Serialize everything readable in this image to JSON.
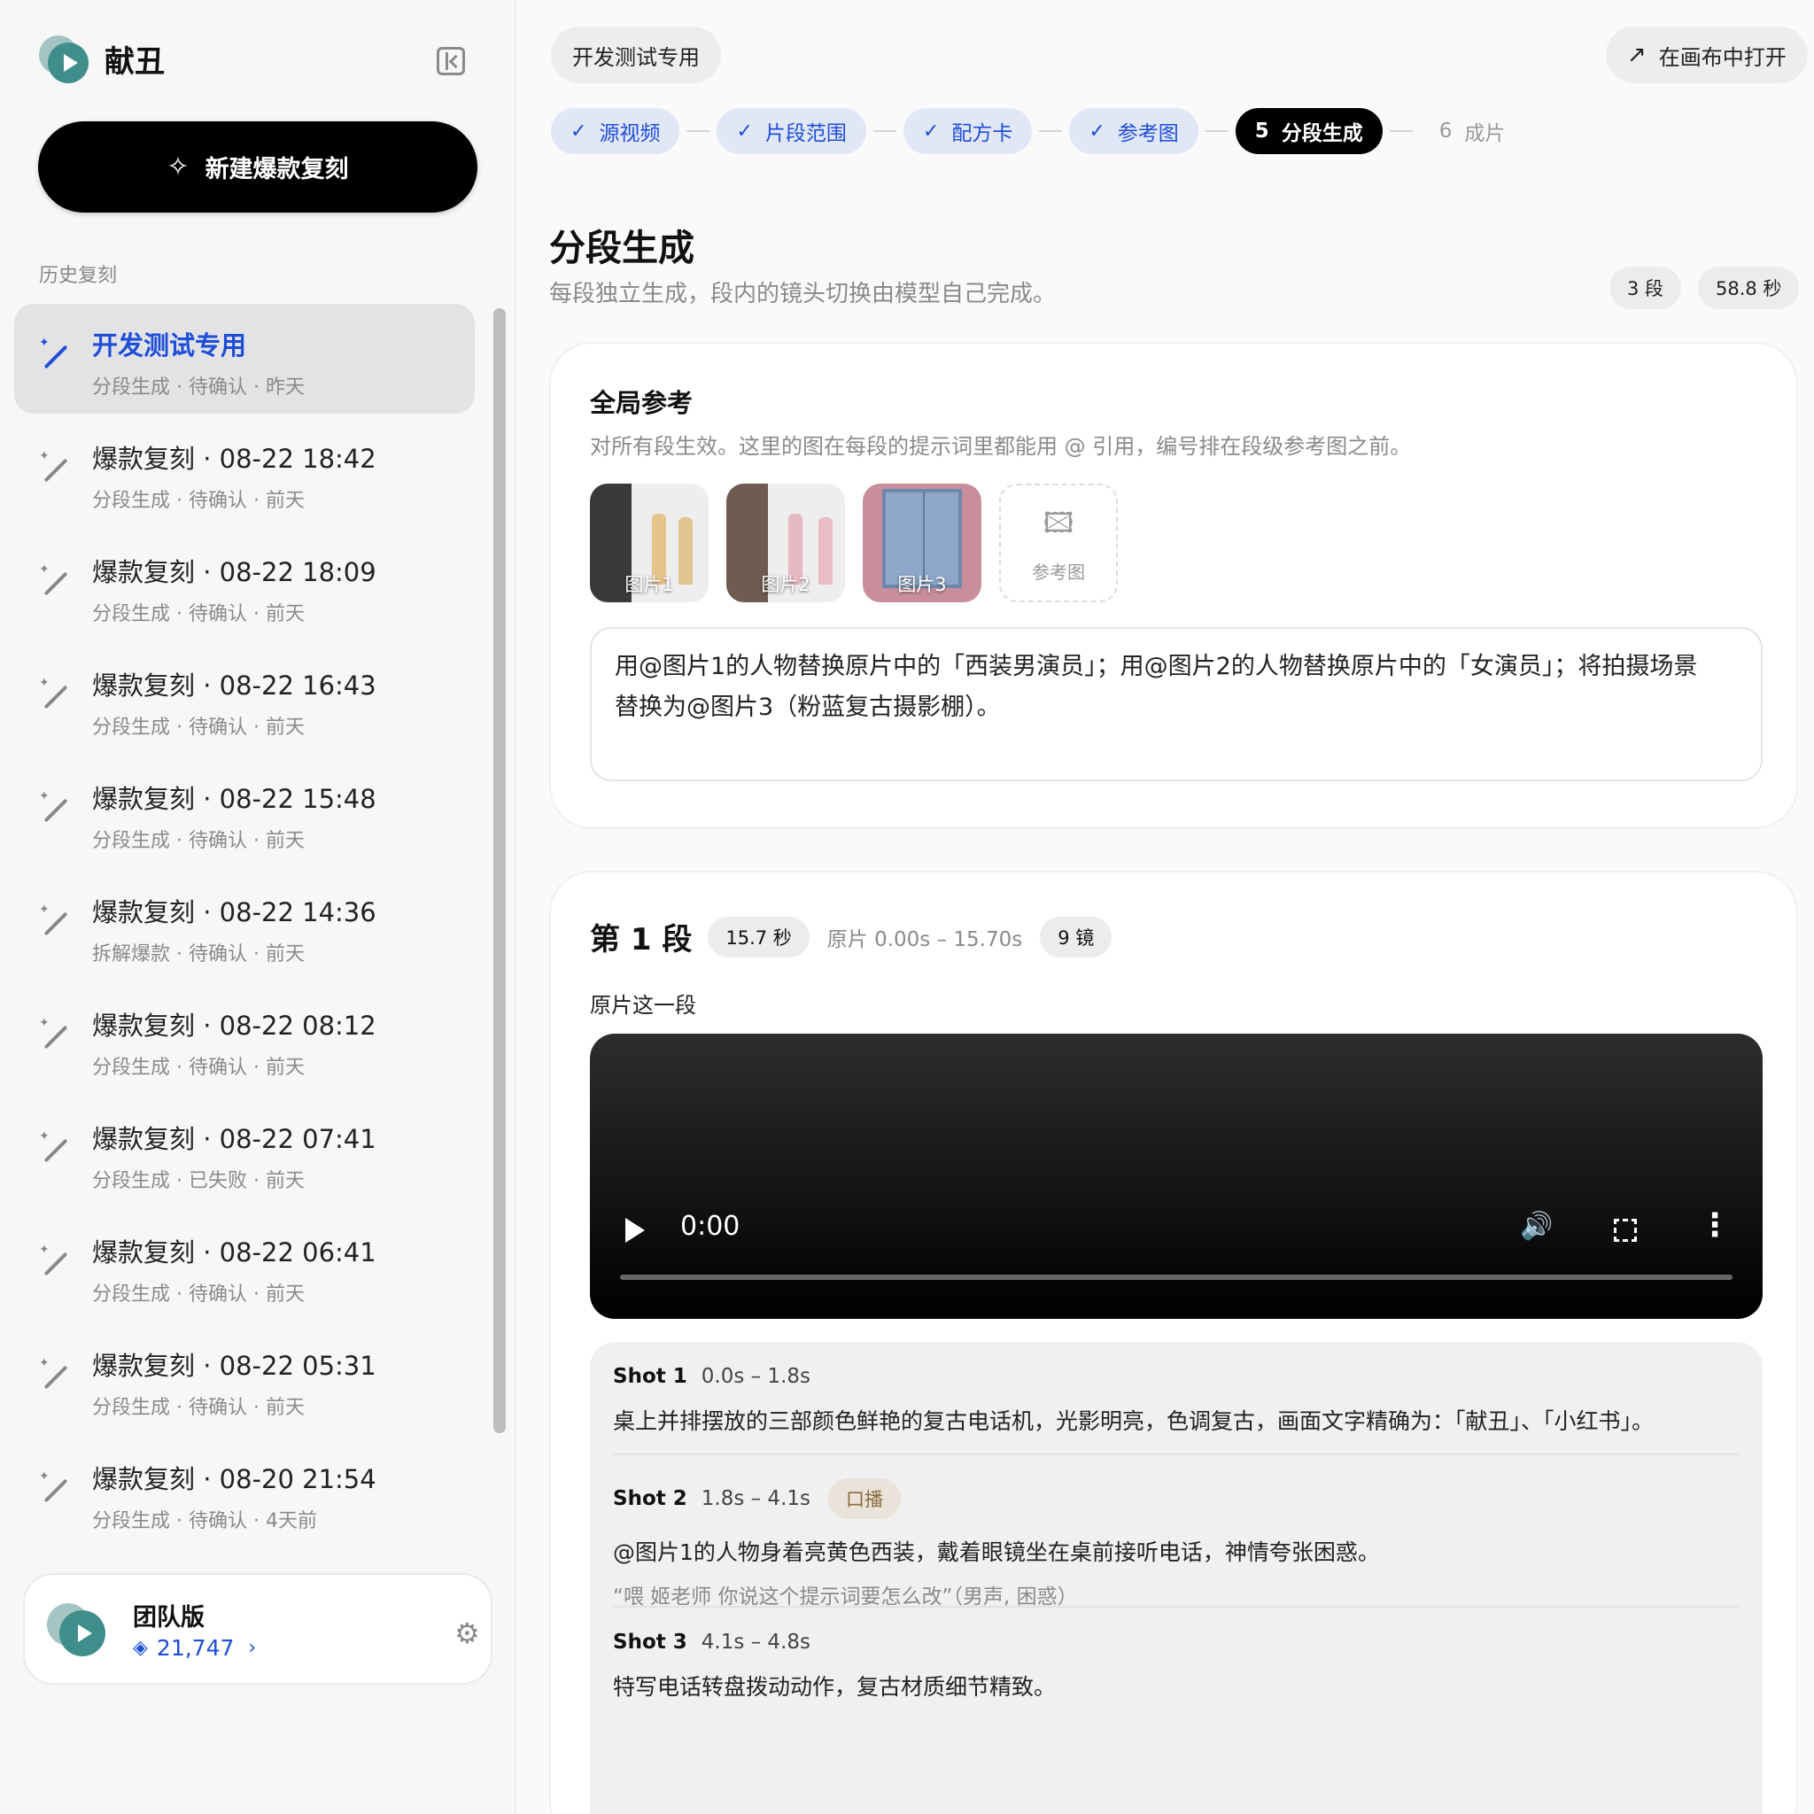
{
  "app": {
    "name": "献丑"
  },
  "sidebar": {
    "new_button": "新建爆款复刻",
    "history_title": "历史复刻",
    "items": [
      {
        "title": "开发测试专用",
        "status": "分段生成 · 待确认 · 昨天",
        "active": true
      },
      {
        "title": "爆款复刻 · 08-22 18:42",
        "status": "分段生成 · 待确认 · 前天"
      },
      {
        "title": "爆款复刻 · 08-22 18:09",
        "status": "分段生成 · 待确认 · 前天"
      },
      {
        "title": "爆款复刻 · 08-22 16:43",
        "status": "分段生成 · 待确认 · 前天"
      },
      {
        "title": "爆款复刻 · 08-22 15:48",
        "status": "分段生成 · 待确认 · 前天"
      },
      {
        "title": "爆款复刻 · 08-22 14:36",
        "status": "拆解爆款 · 待确认 · 前天"
      },
      {
        "title": "爆款复刻 · 08-22 08:12",
        "status": "分段生成 · 待确认 · 前天"
      },
      {
        "title": "爆款复刻 · 08-22 07:41",
        "status": "分段生成 · 已失败 · 前天"
      },
      {
        "title": "爆款复刻 · 08-22 06:41",
        "status": "分段生成 · 待确认 · 前天"
      },
      {
        "title": "爆款复刻 · 08-22 05:31",
        "status": "分段生成 · 待确认 · 前天"
      },
      {
        "title": "爆款复刻 · 08-20 21:54",
        "status": "分段生成 · 待确认 · 4天前"
      }
    ],
    "team": {
      "plan": "团队版",
      "credits": "21,747"
    }
  },
  "header": {
    "project": "开发测试专用",
    "open_canvas": "在画布中打开",
    "steps": [
      {
        "label": "源视频",
        "state": "done"
      },
      {
        "label": "片段范围",
        "state": "done"
      },
      {
        "label": "配方卡",
        "state": "done"
      },
      {
        "label": "参考图",
        "state": "done"
      },
      {
        "num": "5",
        "label": "分段生成",
        "state": "current"
      },
      {
        "num": "6",
        "label": "成片",
        "state": "todo"
      }
    ]
  },
  "page": {
    "title": "分段生成",
    "subtitle": "每段独立生成，段内的镜头切换由模型自己完成。",
    "segments_count": "3 段",
    "duration": "58.8 秒"
  },
  "global_ref": {
    "title": "全局参考",
    "desc": "对所有段生效。这里的图在每段的提示词里都能用 @ 引用，编号排在段级参考图之前。",
    "images": [
      "图片1",
      "图片2",
      "图片3"
    ],
    "add_label": "参考图",
    "prompt_line1": "用@图片1的人物替换原片中的「西装男演员」；用@图片2的人物替换原片中的「女演员」；将拍摄场景",
    "prompt_line2": "替换为@图片3（粉蓝复古摄影棚）。"
  },
  "segment": {
    "title": "第 1 段",
    "duration": "15.7 秒",
    "range": "原片 0.00s – 15.70s",
    "shots_count": "9 镜",
    "source_label": "原片这一段",
    "video_time": "0:00",
    "shots": [
      {
        "name": "Shot 1",
        "range": "0.0s – 1.8s",
        "desc": "桌上并排摆放的三部颜色鲜艳的复古电话机，光影明亮，色调复古，画面文字精确为：「献丑」、「小红书」。"
      },
      {
        "name": "Shot 2",
        "range": "1.8s – 4.1s",
        "tag": "口播",
        "desc": "@图片1的人物身着亮黄色西装，戴着眼镜坐在桌前接听电话，神情夸张困惑。",
        "quote": "“喂 姬老师 你说这个提示词要怎么改”（男声, 困惑）"
      },
      {
        "name": "Shot 3",
        "range": "4.1s – 4.8s",
        "desc": "特写电话转盘拨动动作，复古材质细节精致。"
      }
    ]
  }
}
